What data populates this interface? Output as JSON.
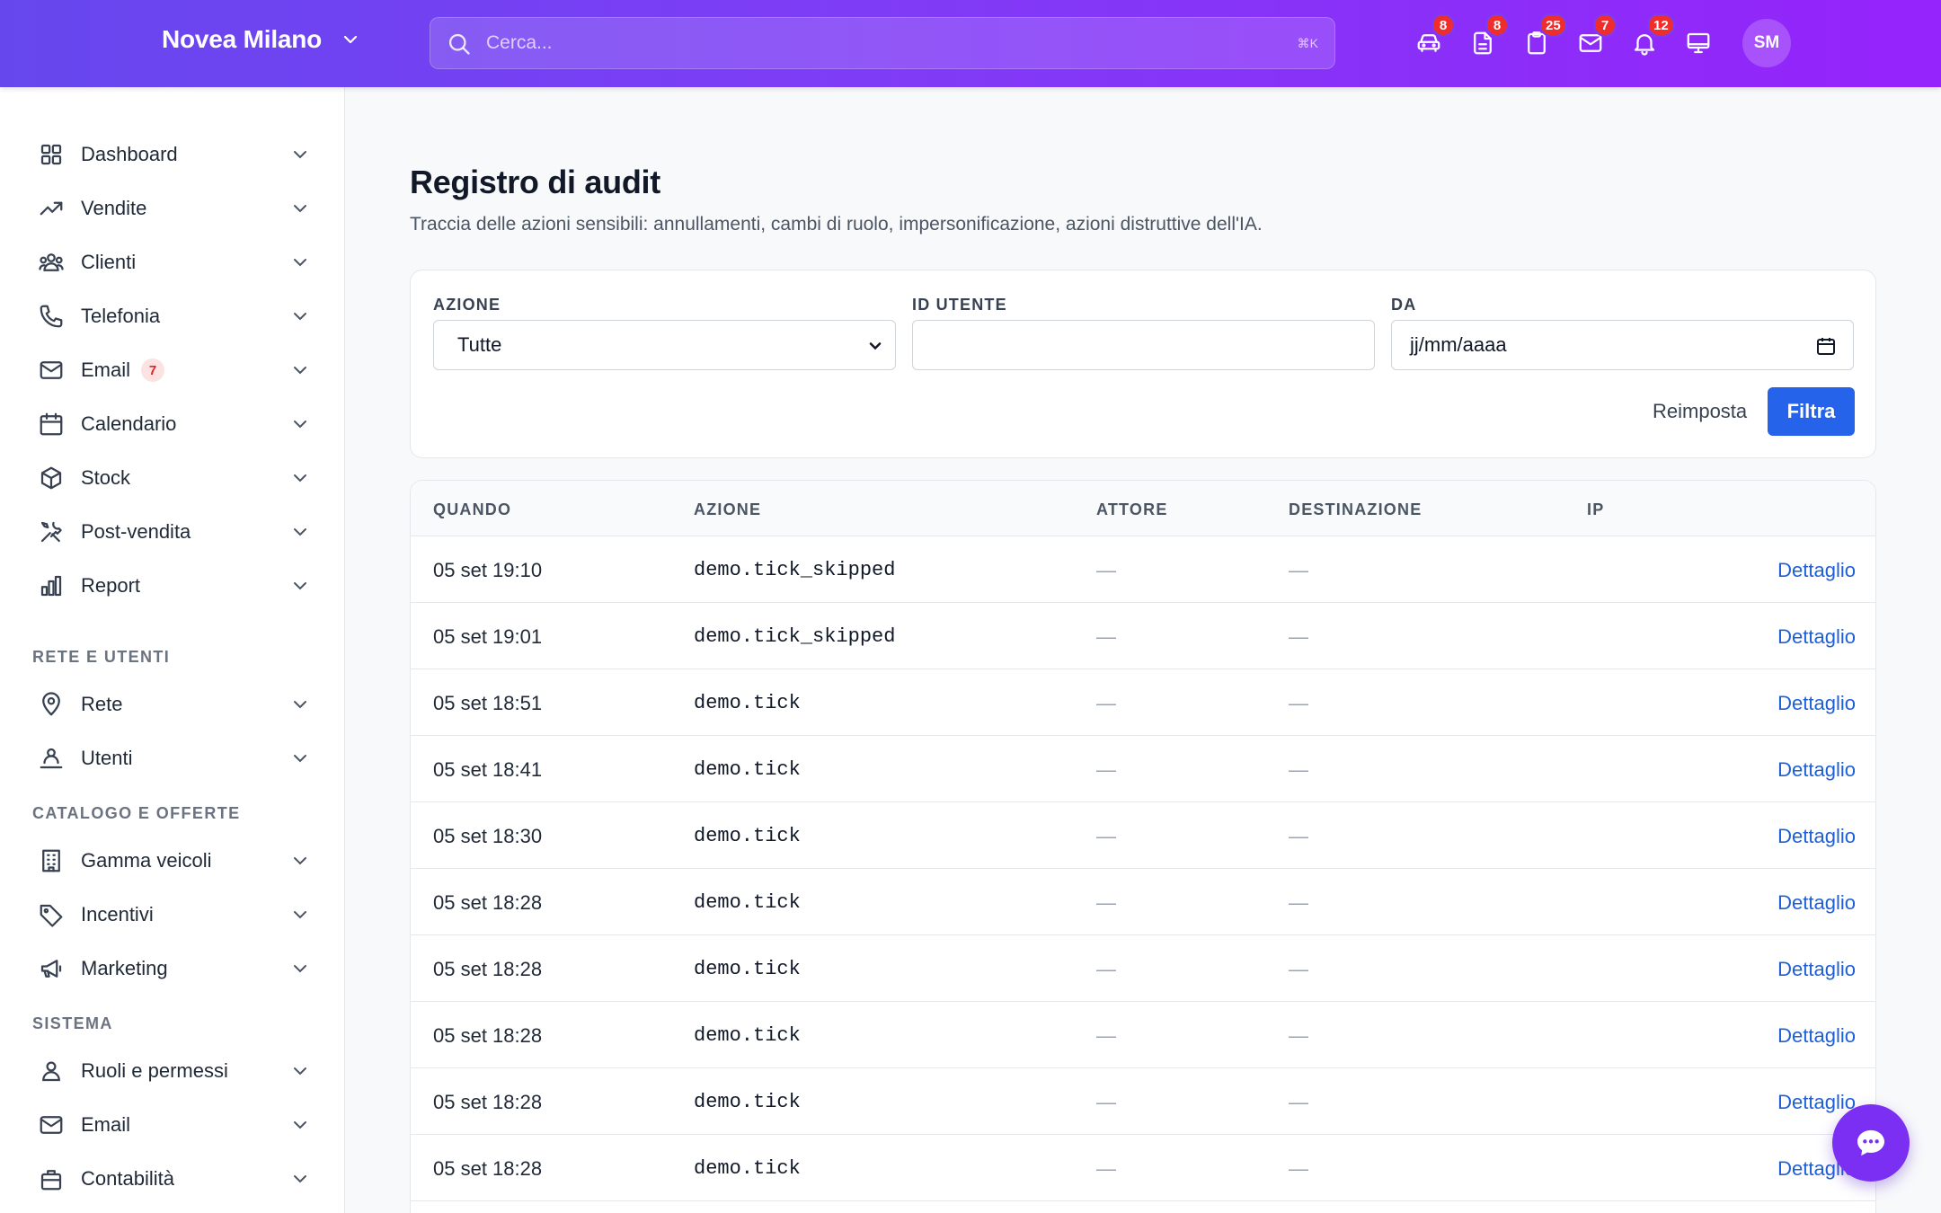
{
  "header": {
    "brand": "Novea Milano",
    "search_placeholder": "Cerca...",
    "search_shortcut": "⌘K",
    "icons": [
      {
        "name": "car-icon",
        "badge": "8"
      },
      {
        "name": "document-icon",
        "badge": "8"
      },
      {
        "name": "clipboard-icon",
        "badge": "25"
      },
      {
        "name": "mail-icon",
        "badge": "7"
      },
      {
        "name": "bell-icon",
        "badge": "12"
      },
      {
        "name": "monitor-icon",
        "badge": ""
      }
    ],
    "avatar": "SM"
  },
  "sidebar": {
    "items": [
      {
        "label": "Dashboard",
        "icon": "grid-icon"
      },
      {
        "label": "Vendite",
        "icon": "trending-up-icon"
      },
      {
        "label": "Clienti",
        "icon": "users-icon"
      },
      {
        "label": "Telefonia",
        "icon": "phone-icon"
      },
      {
        "label": "Email",
        "icon": "mail-icon",
        "count": "7"
      },
      {
        "label": "Calendario",
        "icon": "calendar-icon"
      },
      {
        "label": "Stock",
        "icon": "box-icon"
      },
      {
        "label": "Post-vendita",
        "icon": "tools-icon"
      },
      {
        "label": "Report",
        "icon": "bar-chart-icon"
      }
    ],
    "section_network": "RETE E UTENTI",
    "network_items": [
      {
        "label": "Rete",
        "icon": "map-pin-icon"
      },
      {
        "label": "Utenti",
        "icon": "user-group-icon"
      }
    ],
    "section_catalog": "CATALOGO E OFFERTE",
    "catalog_items": [
      {
        "label": "Gamma veicoli",
        "icon": "building-icon"
      },
      {
        "label": "Incentivi",
        "icon": "tag-icon"
      },
      {
        "label": "Marketing",
        "icon": "megaphone-icon"
      }
    ],
    "section_system": "SISTEMA",
    "system_items": [
      {
        "label": "Ruoli e permessi",
        "icon": "user-icon"
      },
      {
        "label": "Email",
        "icon": "mail-icon"
      },
      {
        "label": "Contabilità",
        "icon": "briefcase-icon"
      }
    ]
  },
  "main": {
    "title": "Registro di audit",
    "subtitle": "Traccia delle azioni sensibili: annullamenti, cambi di ruolo, impersonificazione, azioni distruttive dell'IA."
  },
  "filters": {
    "action_label": "AZIONE",
    "action_value": "Tutte",
    "user_label": "ID UTENTE",
    "user_value": "",
    "from_label": "DA",
    "from_placeholder": "jj/mm/aaaa",
    "reset_label": "Reimposta",
    "filter_label": "Filtra"
  },
  "table": {
    "columns": [
      "QUANDO",
      "AZIONE",
      "ATTORE",
      "DESTINAZIONE",
      "IP"
    ],
    "rows": [
      {
        "when": "05 set 19:10",
        "action": "demo.tick_skipped",
        "actor": "—",
        "target": "—",
        "ip": "",
        "link": "Dettaglio"
      },
      {
        "when": "05 set 19:01",
        "action": "demo.tick_skipped",
        "actor": "—",
        "target": "—",
        "ip": "",
        "link": "Dettaglio"
      },
      {
        "when": "05 set 18:51",
        "action": "demo.tick",
        "actor": "—",
        "target": "—",
        "ip": "",
        "link": "Dettaglio"
      },
      {
        "when": "05 set 18:41",
        "action": "demo.tick",
        "actor": "—",
        "target": "—",
        "ip": "",
        "link": "Dettaglio"
      },
      {
        "when": "05 set 18:30",
        "action": "demo.tick",
        "actor": "—",
        "target": "—",
        "ip": "",
        "link": "Dettaglio"
      },
      {
        "when": "05 set 18:28",
        "action": "demo.tick",
        "actor": "—",
        "target": "—",
        "ip": "",
        "link": "Dettaglio"
      },
      {
        "when": "05 set 18:28",
        "action": "demo.tick",
        "actor": "—",
        "target": "—",
        "ip": "",
        "link": "Dettaglio"
      },
      {
        "when": "05 set 18:28",
        "action": "demo.tick",
        "actor": "—",
        "target": "—",
        "ip": "",
        "link": "Dettaglio"
      },
      {
        "when": "05 set 18:28",
        "action": "demo.tick",
        "actor": "—",
        "target": "—",
        "ip": "",
        "link": "Dettaglio"
      },
      {
        "when": "05 set 18:28",
        "action": "demo.tick",
        "actor": "—",
        "target": "—",
        "ip": "",
        "link": "Dettaglio"
      }
    ]
  },
  "colors": {
    "header_start": "#6647ee",
    "header_end": "#9523fb",
    "primary_button": "#2563eb",
    "link": "#1d5fd6",
    "badge": "#ef2d2d",
    "chat_fab": "#7b2ff2"
  }
}
